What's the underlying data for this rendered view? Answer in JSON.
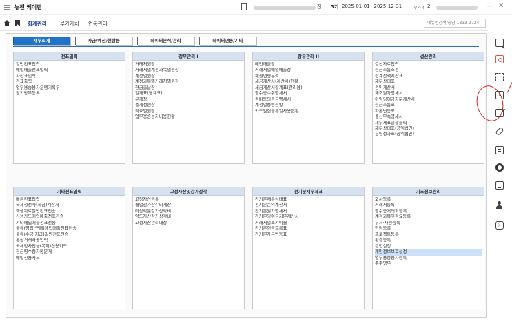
{
  "titlebar": {
    "app_title": "뉴젠 케이렙",
    "company": "전",
    "count": "3기",
    "period": "2025-01-01~2025-12-31",
    "dept_label": "부가세",
    "dept": "2",
    "minimize": "—",
    "close": "✕"
  },
  "navbar": {
    "items": [
      "회계관리",
      "부가가치",
      "연동관리"
    ],
    "search_placeholder": "메뉴명검색/상담 1833-2734"
  },
  "tabs": [
    "재무회계",
    "자금/예산/현장등",
    "데이터분석/관리",
    "데이터연동/기타"
  ],
  "cards": [
    {
      "title": "전표입력",
      "items": [
        "일반전표입력",
        "매입매출전표입력",
        "사산표입력",
        "전표출력",
        "업무용승용차운행기록부",
        "정기장부등록"
      ]
    },
    {
      "title": "장부관리 I",
      "items": [
        "거래처원장",
        "거래처별계정과목별원장",
        "계정별원장",
        "계정과목별거래처별원장",
        "현금출납장",
        "일계표(월계표)",
        "분개장",
        "총계정원장",
        "적요별원장",
        "업무용승용차비용현황"
      ]
    },
    {
      "title": "장부관리 II",
      "items": [
        "매입매출장",
        "거래처별매입매출장",
        "채권연령분석",
        "세금계산서(계산서)현황",
        "세금계산서합계표(관리용)",
        "영수증수취명세서",
        "경비등의송금명세서",
        "계정별증빙현황",
        "카드및현금휴일사용현황"
      ]
    },
    {
      "title": "결산관리",
      "items": [
        "결산자료입력",
        "현금흐름조정",
        "합계잔액시산표",
        "재무상태표",
        "손익계산서",
        "제조원가명세서",
        "이익잉여금처분계산서",
        "현금흐름표",
        "자본변동표",
        "결산부속명세서",
        "재무제표일괄출력",
        "재무상태표(공익법인)",
        "운영성과표(공익법인)"
      ]
    },
    {
      "title": "기타전표입력",
      "items": [
        "빠른전표입력",
        "국세청전자(세금)계산서",
        "엑셀자료일반전표전송",
        "신용카드매입매출전표전송",
        "기타매입매출전표전송",
        "물류(영업,구매)매입매출전표전송",
        "물류(수금,지급)일반전표전송",
        "통장거래자동입력",
        "국세청사업용(복지)신용카드",
        "현금영수증자동분개",
        "매입신용카드"
      ]
    },
    {
      "title": "고정자산및감가상각",
      "items": [
        "고정자산등록",
        "월별감가상각비계상",
        "미상각분감가상각비",
        "양도자산감가상각비",
        "고정자산관리대장"
      ]
    },
    {
      "title": "전기분재무제표",
      "items": [
        "전기분재무상태표",
        "전기분손익계산서",
        "전기분원가명세서",
        "전기분잉여금처분계산서",
        "거래처별초기이월",
        "전기분현금흐름표",
        "전기분자본변동표"
      ]
    },
    {
      "title": "기초정보관리",
      "items": [
        "회사등록",
        "거래처등록",
        "영수증거래처등록",
        "계정과목및적요등록",
        "부서·사원등록",
        "현장등록",
        "프로젝트등록",
        "환경등록",
        "관한설정",
        "개인정보보호설정",
        "업무용승용차등록",
        "주주명부"
      ],
      "highlighted_index": 9
    }
  ],
  "sidebar": [
    "search-icon",
    "document-icon",
    "expand-icon",
    "info-icon",
    "edit-icon",
    "link-icon",
    "calculator-icon",
    "globe-icon",
    "monitor-icon",
    "people-icon",
    "play-icon"
  ]
}
